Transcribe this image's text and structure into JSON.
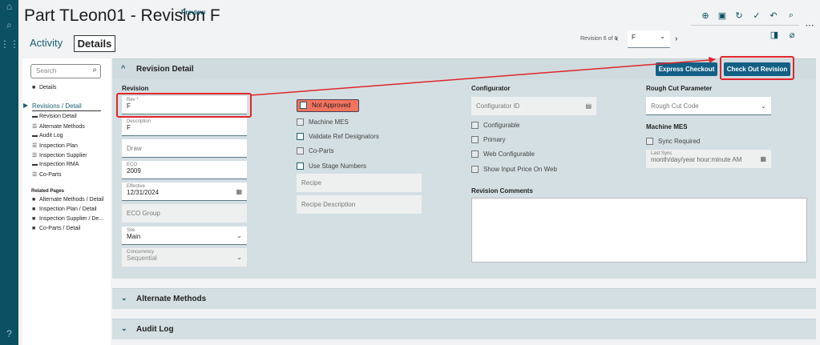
{
  "header": {
    "title": "Part TLeon01 - Revision F",
    "badge": "Preview"
  },
  "tabs": [
    "Activity",
    "Details"
  ],
  "toolbar": {
    "icons": [
      "add-icon",
      "save-icon",
      "refresh-icon",
      "clear-icon",
      "undo-icon",
      "search-icon",
      "more-icon",
      "panel-icon",
      "attachment-icon"
    ]
  },
  "revision_nav": {
    "count": "Revision 6 of 6",
    "selected": "F"
  },
  "sidebar": {
    "search_placeholder": "Search",
    "top": "Details",
    "group": "Revisions / Detail",
    "items": [
      "Revision Detail",
      "Alternate Methods",
      "Audit Log",
      "Inspection Plan",
      "Inspection Supplier",
      "Inspection RMA",
      "Co-Parts"
    ],
    "related_title": "Related Pages",
    "related": [
      "Alternate Methods / Detail",
      "Inspection Plan / Detail",
      "Inspection Supplier / De...",
      "Co-Parts / Detail"
    ]
  },
  "section": {
    "title": "Revision Detail",
    "express_checkout": "Express Checkout",
    "check_out": "Check Out Revision"
  },
  "revision": {
    "heading": "Revision",
    "rev_label": "Rev *",
    "rev_value": "F",
    "desc_label": "Description",
    "desc_value": "F",
    "draw": "Draw",
    "eco_label": "ECO",
    "eco_value": "2009",
    "effective_label": "Effective",
    "effective_value": "12/31/2024",
    "eco_group": "ECO Group",
    "site_label": "Site",
    "site_value": "Main",
    "concurrency_label": "Concurrency",
    "concurrency_value": "Sequential"
  },
  "status": {
    "not_approved": "Not Approved",
    "machine_mes": "Machine MES",
    "validate": "Validate Ref Designators",
    "coparts": "Co-Parts",
    "stage": "Use Stage Numbers",
    "recipe": "Recipe",
    "recipe_desc": "Recipe Description"
  },
  "configurator": {
    "heading": "Configurator",
    "id": "Configurator ID",
    "configurable": "Configurable",
    "primary": "Primary",
    "web": "Web Configurable",
    "price": "Show Input Price On Web",
    "comments": "Revision Comments"
  },
  "rough": {
    "heading": "Rough Cut Parameter",
    "code": "Rough Cut Code",
    "mes_heading": "Machine MES",
    "sync": "Sync Required",
    "last_sync_label": "Last Sync",
    "last_sync_ph": "month/day/year hour:minute AM"
  },
  "sections": [
    "Alternate Methods",
    "Audit Log"
  ],
  "annotation_color": "#e0262a"
}
